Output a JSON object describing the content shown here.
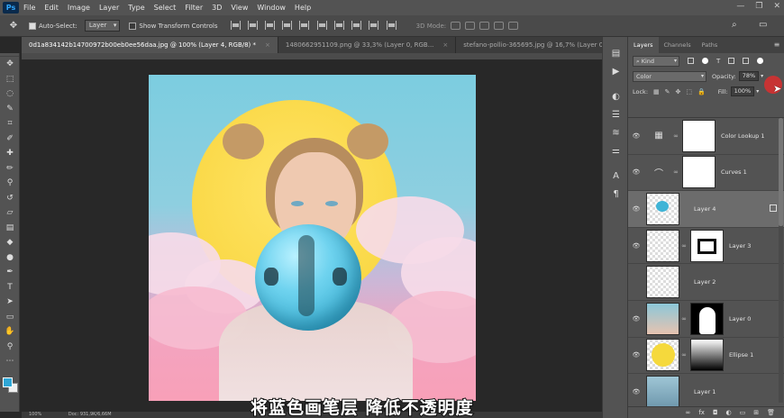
{
  "app": {
    "logo": "Ps"
  },
  "menu": [
    "File",
    "Edit",
    "Image",
    "Layer",
    "Type",
    "Select",
    "Filter",
    "3D",
    "View",
    "Window",
    "Help"
  ],
  "window_controls": [
    "—",
    "❐",
    "✕"
  ],
  "options": {
    "auto_select_label": "Auto-Select:",
    "auto_select_value": "Layer",
    "transform_label": "Show Transform Controls",
    "mode3d_label": "3D Mode:"
  },
  "tabs": [
    {
      "label": "0d1a834142b14700972b00eb0ee56daa.jpg @ 100% (Layer 4, RGB/8) *"
    },
    {
      "label": "1480662951109.png @ 33,3% (Layer 0, RGB..."
    },
    {
      "label": "stefano-pollio-365695.jpg @ 16,7% (Layer 0, RGB..."
    }
  ],
  "status": {
    "zoom": "100%",
    "doc": "Doc: 931,9K/6,66M"
  },
  "subtitle": "将蓝色画笔层 降低不透明度",
  "panel": {
    "tabs": [
      "Layers",
      "Channels",
      "Paths"
    ],
    "kind_label": "Kind",
    "blend_mode": "Color",
    "opacity_label": "Opacity:",
    "opacity_value": "78%",
    "lock_label": "Lock:",
    "fill_label": "Fill:",
    "fill_value": "100%"
  },
  "layers": [
    {
      "name": "Color Lookup 1",
      "thumb": "adj-grid",
      "mask": "white",
      "active": false
    },
    {
      "name": "Curves 1",
      "thumb": "adj-curve",
      "mask": "white",
      "active": false
    },
    {
      "name": "Layer 4",
      "thumb": "blue-blob",
      "mask": "none",
      "active": true
    },
    {
      "name": "Layer 3",
      "thumb": "transparent",
      "mask": "frame",
      "active": false
    },
    {
      "name": "Layer 2",
      "thumb": "transparent",
      "mask": "none",
      "active": false
    },
    {
      "name": "Layer 0",
      "thumb": "portrait",
      "mask": "silhouette",
      "active": false
    },
    {
      "name": "Ellipse 1",
      "thumb": "yellow-circle",
      "mask": "gradient",
      "active": false
    },
    {
      "name": "Layer 1",
      "thumb": "sky",
      "mask": "none",
      "active": false
    }
  ],
  "colors": {
    "foreground": "#2fa7d6",
    "background": "#f0f0f0",
    "accent_red": "#c73333"
  }
}
